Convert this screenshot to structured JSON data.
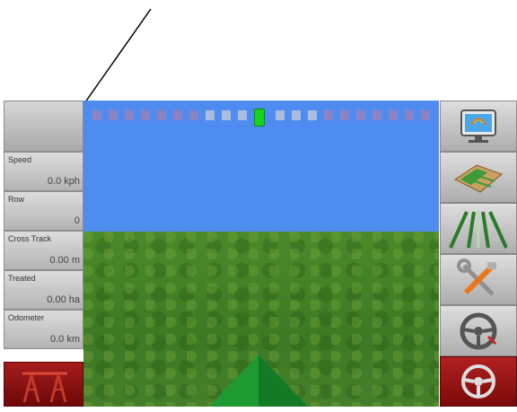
{
  "left_panel": {
    "readouts": [
      {
        "label": "Speed",
        "value": "0.0 kph"
      },
      {
        "label": "Row",
        "value": "0"
      },
      {
        "label": "Cross Track",
        "value": "0.00 m"
      },
      {
        "label": "Treated",
        "value": "0.00 ha"
      },
      {
        "label": "Odometer",
        "value": "0.0 km"
      }
    ]
  },
  "toolbar_icons": [
    "monitor-icon",
    "field-map-icon",
    "guidance-lines-icon",
    "tools-icon",
    "steering-wheel-icon",
    "steering-wheel-icon"
  ],
  "colors": {
    "sky": "#4f8cf0",
    "active_section": "#17d41e",
    "red_button": "#9a1414"
  }
}
